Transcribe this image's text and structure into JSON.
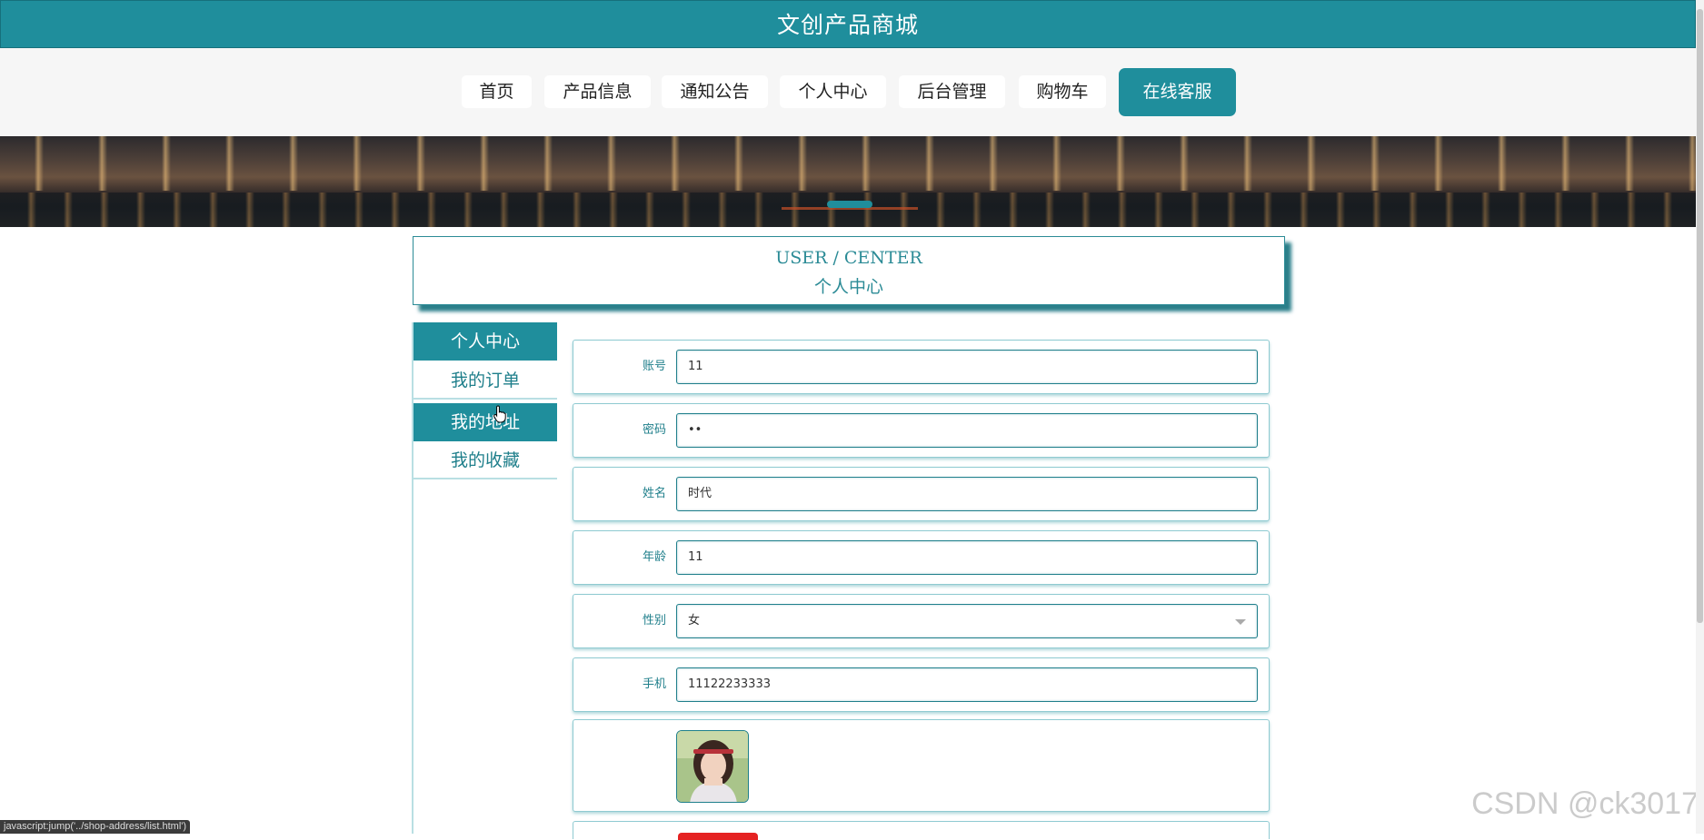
{
  "header": {
    "title": "文创产品商城"
  },
  "nav": {
    "items": [
      "首页",
      "产品信息",
      "通知公告",
      "个人中心",
      "后台管理",
      "购物车"
    ],
    "service": "在线客服"
  },
  "center": {
    "en": "USER / CENTER",
    "cn": "个人中心"
  },
  "sidebar": {
    "items": [
      "个人中心",
      "我的订单",
      "我的地址",
      "我的收藏"
    ]
  },
  "form": {
    "rows": [
      {
        "label": "账号",
        "value": "11"
      },
      {
        "label": "密码",
        "value": "••"
      },
      {
        "label": "姓名",
        "value": "时代"
      },
      {
        "label": "年龄",
        "value": "11"
      },
      {
        "label": "性别",
        "value": "女"
      },
      {
        "label": "手机",
        "value": "11122233333"
      }
    ]
  },
  "status": {
    "url": "javascript:jump('../shop-address/list.html')"
  },
  "watermark": "CSDN @ck3017"
}
